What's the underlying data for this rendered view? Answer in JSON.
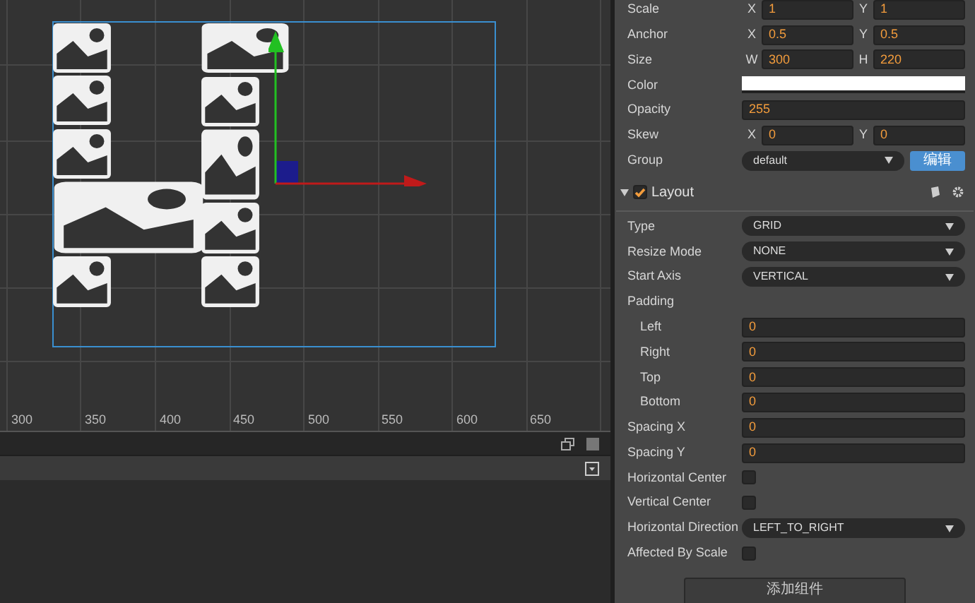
{
  "scene": {
    "ruler_labels": [
      "300",
      "350",
      "400",
      "450",
      "500",
      "550",
      "600",
      "650"
    ]
  },
  "inspector": {
    "properties": [
      {
        "kind": "vec2",
        "label": "Scale",
        "fields": [
          {
            "axis": "X",
            "value": "1"
          },
          {
            "axis": "Y",
            "value": "1"
          }
        ]
      },
      {
        "kind": "vec2",
        "label": "Anchor",
        "fields": [
          {
            "axis": "X",
            "value": "0.5"
          },
          {
            "axis": "Y",
            "value": "0.5"
          }
        ]
      },
      {
        "kind": "vec2",
        "label": "Size",
        "fields": [
          {
            "axis": "W",
            "value": "300"
          },
          {
            "axis": "H",
            "value": "220"
          }
        ]
      },
      {
        "kind": "color",
        "label": "Color",
        "color": "#ffffff"
      },
      {
        "kind": "number",
        "label": "Opacity",
        "value": "255"
      },
      {
        "kind": "vec2",
        "label": "Skew",
        "fields": [
          {
            "axis": "X",
            "value": "0"
          },
          {
            "axis": "Y",
            "value": "0"
          }
        ]
      },
      {
        "kind": "group",
        "label": "Group",
        "value": "default",
        "button": "编辑"
      }
    ],
    "component": {
      "title": "Layout",
      "checked": true,
      "expanded": true,
      "properties": [
        {
          "kind": "select",
          "label": "Type",
          "value": "GRID"
        },
        {
          "kind": "select",
          "label": "Resize Mode",
          "value": "NONE"
        },
        {
          "kind": "select",
          "label": "Start Axis",
          "value": "VERTICAL"
        },
        {
          "kind": "heading",
          "label": "Padding"
        },
        {
          "kind": "number",
          "label": "Left",
          "indent": true,
          "value": "0"
        },
        {
          "kind": "number",
          "label": "Right",
          "indent": true,
          "value": "0"
        },
        {
          "kind": "number",
          "label": "Top",
          "indent": true,
          "value": "0"
        },
        {
          "kind": "number",
          "label": "Bottom",
          "indent": true,
          "value": "0"
        },
        {
          "kind": "number",
          "label": "Spacing X",
          "value": "0"
        },
        {
          "kind": "number",
          "label": "Spacing Y",
          "value": "0"
        },
        {
          "kind": "checkbox",
          "label": "Horizontal Center",
          "checked": false
        },
        {
          "kind": "checkbox",
          "label": "Vertical Center",
          "checked": false
        },
        {
          "kind": "select",
          "label": "Horizontal Direction",
          "value": "LEFT_TO_RIGHT"
        },
        {
          "kind": "checkbox",
          "label": "Affected By Scale",
          "checked": false
        }
      ]
    },
    "add_button": "添加组件"
  }
}
